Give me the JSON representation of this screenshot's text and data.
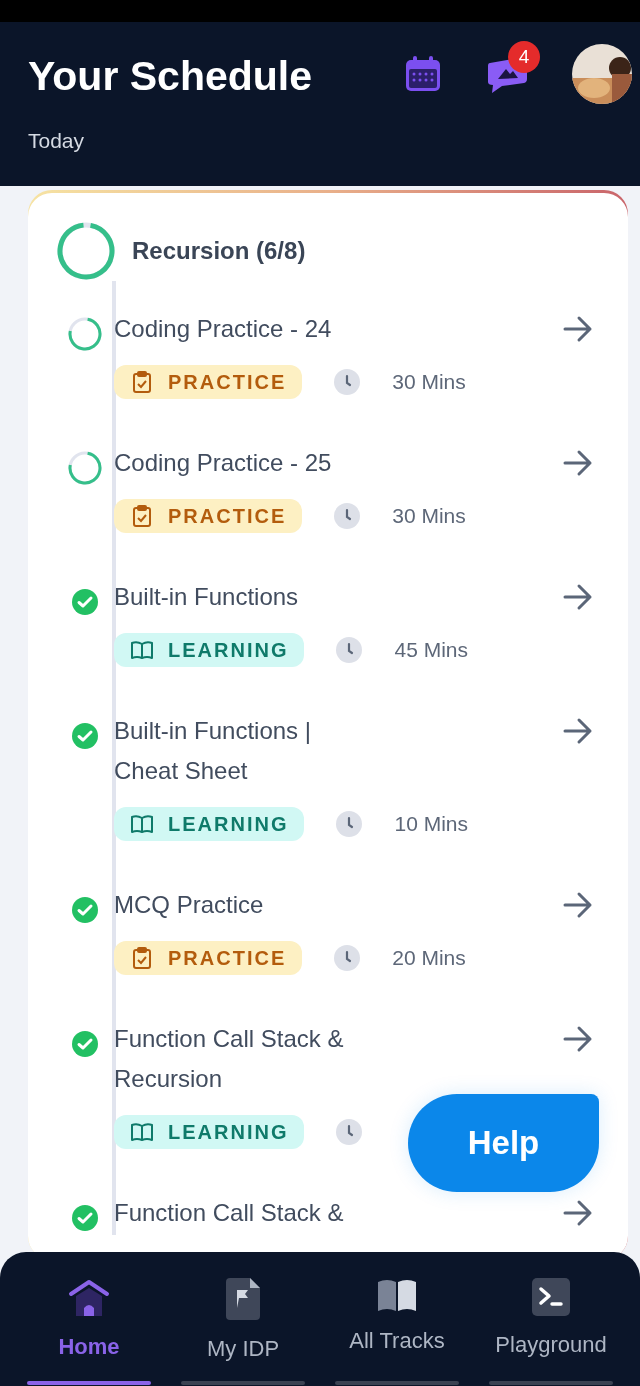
{
  "header": {
    "title": "Your Schedule",
    "subtitle": "Today",
    "notification_count": "4"
  },
  "module": {
    "title": "Recursion (6/8)"
  },
  "items": [
    {
      "title": "Coding Practice - 24",
      "completed": false,
      "tag": {
        "kind": "practice",
        "label": "PRACTICE"
      },
      "duration": "30 Mins"
    },
    {
      "title": "Coding Practice - 25",
      "completed": false,
      "tag": {
        "kind": "practice",
        "label": "PRACTICE"
      },
      "duration": "30 Mins"
    },
    {
      "title": "Built-in Functions",
      "completed": true,
      "tag": {
        "kind": "learning",
        "label": "LEARNING"
      },
      "duration": "45 Mins"
    },
    {
      "title": "Built-in Functions | Cheat Sheet",
      "completed": true,
      "tag": {
        "kind": "learning",
        "label": "LEARNING"
      },
      "duration": "10 Mins"
    },
    {
      "title": "MCQ Practice",
      "completed": true,
      "tag": {
        "kind": "practice",
        "label": "PRACTICE"
      },
      "duration": "20 Mins"
    },
    {
      "title": "Function Call Stack & Recursion",
      "completed": true,
      "tag": {
        "kind": "learning",
        "label": "LEARNING"
      }
    },
    {
      "title": "Function Call Stack &",
      "completed": true
    }
  ],
  "help_button": {
    "label": "Help"
  },
  "nav": [
    {
      "label": "Home",
      "selected": true
    },
    {
      "label": "My IDP",
      "selected": false
    },
    {
      "label": "All Tracks",
      "selected": false
    },
    {
      "label": "Playground",
      "selected": false
    }
  ]
}
